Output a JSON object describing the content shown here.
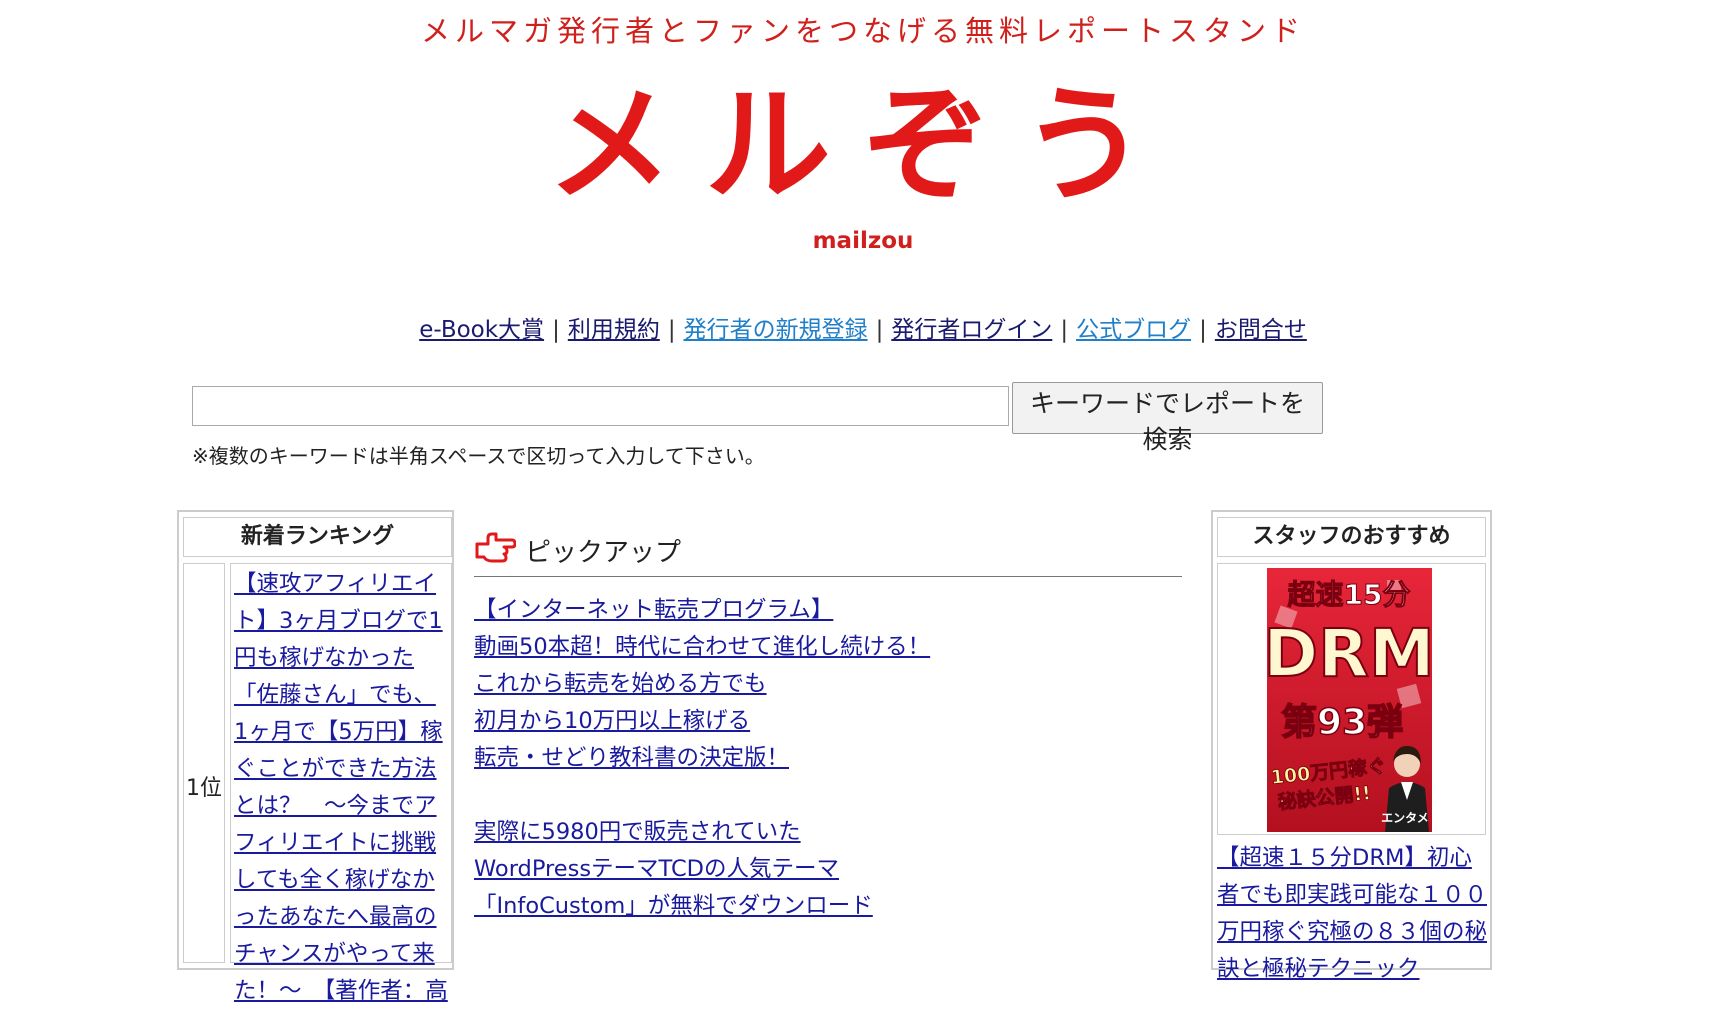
{
  "header": {
    "tagline": "メルマガ発行者とファンをつなげる無料レポートスタンド",
    "logo": "メルぞう",
    "logo_sub": "mailzou"
  },
  "nav": {
    "items": [
      "e-Book大賞",
      "利用規約",
      "発行者の新規登録",
      "発行者ログイン",
      "公式ブログ",
      "お問合せ"
    ],
    "separator": "|"
  },
  "search": {
    "value": "",
    "button_label": "キーワードでレポートを検索",
    "hint": "※複数のキーワードは半角スペースで区切って入力して下さい。"
  },
  "ranking": {
    "title": "新着ランキング",
    "rank_label": "1位",
    "text": "【速攻アフィリエイト】3ヶ月ブログで1円も稼げなかった「佐藤さん」でも、1ヶ月で【5万円】稼ぐことができた方法とは？　～今までアフィリエイトに挑戦しても全く稼げなかったあなたへ最高のチャンスがやって来た！～　【著作者：高"
  },
  "pickup": {
    "title": "ピックアップ",
    "items": [
      "【インターネット転売プログラム】",
      "動画50本超！時代に合わせて進化し続ける！",
      "これから転売を始める方でも",
      "初月から10万円以上稼げる",
      "転売・せどり教科書の決定版！",
      "",
      "実際に5980円で販売されていた",
      "WordPressテーマTCDの人気テーマ",
      "「InfoCustom」が無料でダウンロード"
    ]
  },
  "staff": {
    "title": "スタッフのおすすめ",
    "banner": {
      "line1": "超速15分",
      "line2": "DRM",
      "line3": "第93弾",
      "line4": "100万円稼ぐ",
      "line5": "秘訣公開!!",
      "author": "エンタメ"
    },
    "text": "【超速１５分DRM】初心者でも即実践可能な１００万円稼ぐ究極の８３個の秘訣と極秘テクニック"
  },
  "colors": {
    "brand_red": "#e11919",
    "link": "#1a1a9e",
    "link_light": "#1f7fc9"
  }
}
